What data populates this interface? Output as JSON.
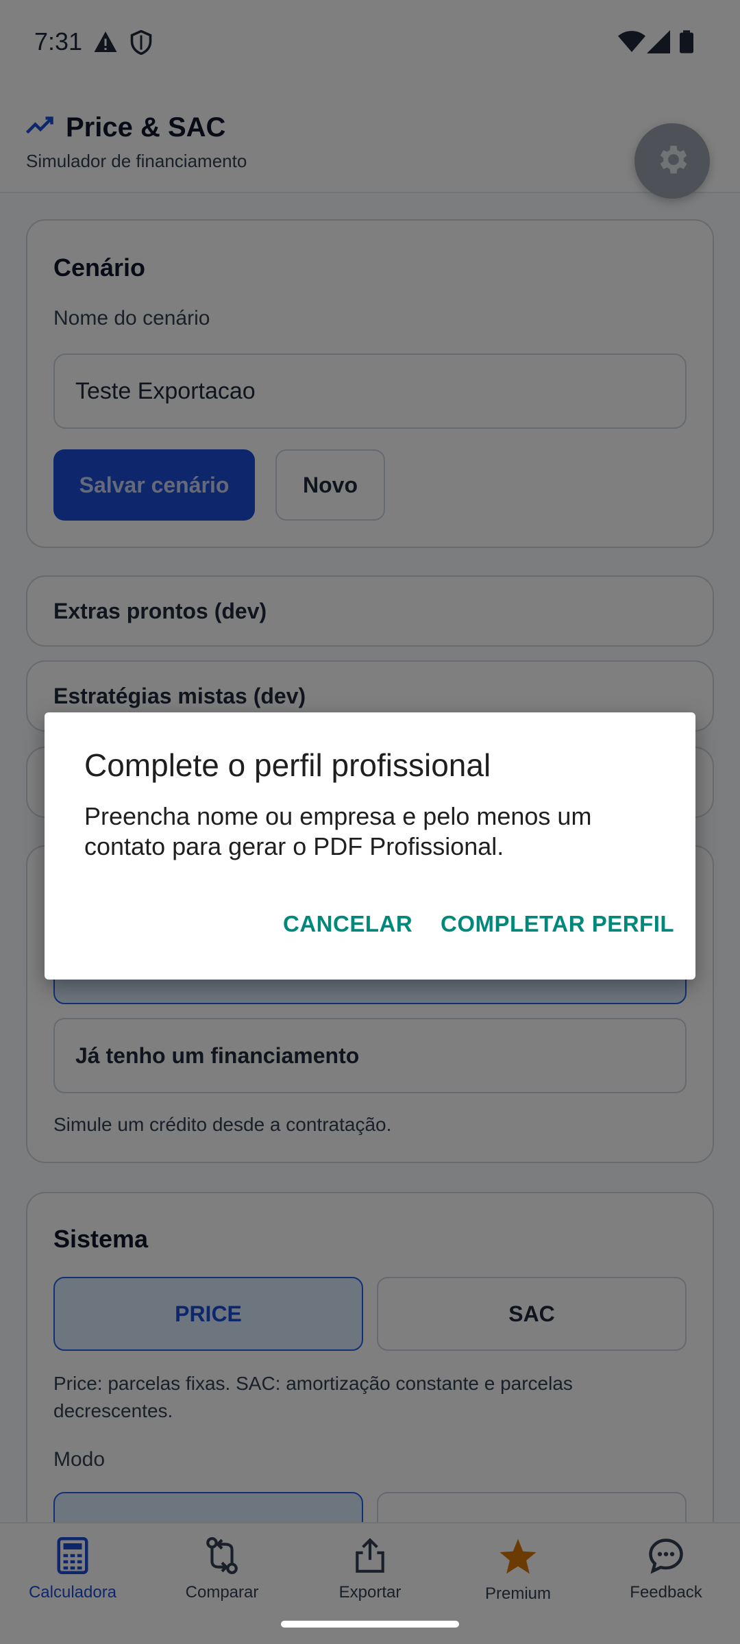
{
  "status_bar": {
    "time": "7:31"
  },
  "header": {
    "title": "Price & SAC",
    "subtitle": "Simulador de financiamento"
  },
  "scenario_card": {
    "title": "Cenário",
    "name_label": "Nome do cenário",
    "name_value": "Teste Exportacao",
    "save_label": "Salvar cenário",
    "new_label": "Novo"
  },
  "extras_card": {
    "label": "Extras prontos (dev)"
  },
  "strategies_card": {
    "label": "Estratégias mistas (dev)"
  },
  "financing_card": {
    "existing_label": "Já tenho um financiamento",
    "hint": "Simule um crédito desde a contratação."
  },
  "system_card": {
    "title": "Sistema",
    "price_label": "PRICE",
    "sac_label": "SAC",
    "description": "Price: parcelas fixas. SAC: amortização constante e parcelas decrescentes.",
    "mode_label": "Modo"
  },
  "bottom_nav": {
    "items": [
      {
        "label": "Calculadora",
        "icon": "calculator-icon",
        "active": true
      },
      {
        "label": "Comparar",
        "icon": "compare-icon",
        "active": false
      },
      {
        "label": "Exportar",
        "icon": "share-icon",
        "active": false
      },
      {
        "label": "Premium",
        "icon": "star-icon",
        "active": false
      },
      {
        "label": "Feedback",
        "icon": "chat-icon",
        "active": false
      }
    ]
  },
  "dialog": {
    "title": "Complete o perfil profissional",
    "body": "Preencha nome ou empresa e pelo menos um contato para gerar o PDF Profissional.",
    "cancel_label": "CANCELAR",
    "confirm_label": "COMPLETAR PERFIL"
  },
  "colors": {
    "primary": "#1d4ed8",
    "dialog_accent": "#00897b",
    "premium": "#d97706"
  }
}
